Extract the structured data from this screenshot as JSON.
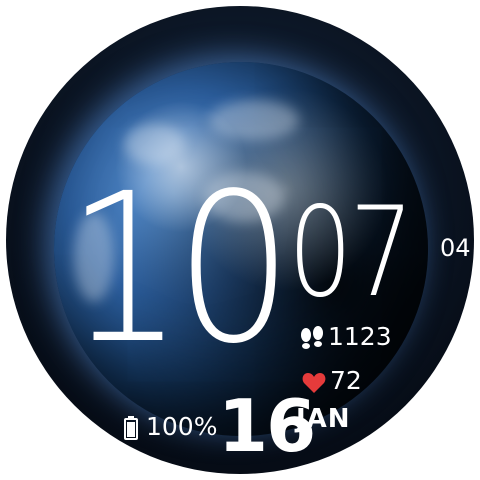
{
  "time": {
    "hour": "10",
    "minute": "07",
    "seconds": "04"
  },
  "stats": {
    "steps": "1123",
    "heart_rate": "72",
    "battery": "100%"
  },
  "date": {
    "day": "16",
    "month": "JAN"
  },
  "colors": {
    "heart": "#e53b3b",
    "text": "#ffffff",
    "background": "#02060c"
  },
  "icons": {
    "steps": "footprints-icon",
    "heart": "heart-icon",
    "battery": "battery-icon"
  }
}
